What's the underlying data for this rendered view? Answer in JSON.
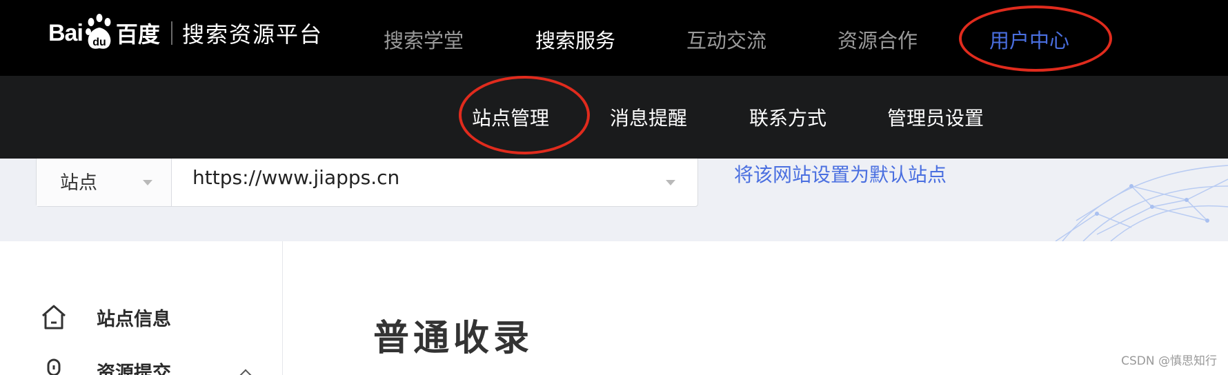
{
  "logo": {
    "brand_left": "Bai",
    "brand_mid": "du",
    "brand_cn": "百度",
    "platform": "搜索资源平台"
  },
  "topnav": {
    "items": [
      "搜索学堂",
      "搜索服务",
      "互动交流",
      "资源合作",
      "用户中心"
    ],
    "active": "搜索服务",
    "highlighted": "用户中心"
  },
  "subnav": {
    "items": [
      "站点管理",
      "消息提醒",
      "联系方式",
      "管理员设置"
    ]
  },
  "sitebar": {
    "label": "站点",
    "url": "https://www.jiapps.cn",
    "default_link": "将该网站设置为默认站点"
  },
  "sidebar": {
    "items": [
      {
        "label": "站点信息",
        "icon": "home-icon"
      },
      {
        "label": "资源提交",
        "icon": "upload-icon"
      }
    ]
  },
  "main": {
    "title": "普通收录"
  },
  "watermark": "CSDN @慎思知行",
  "colors": {
    "topnav_bg": "#000000",
    "subnav_bg": "#1a1b1c",
    "accent_blue": "#4a6fe0",
    "annotation_red": "#e02b1d"
  }
}
